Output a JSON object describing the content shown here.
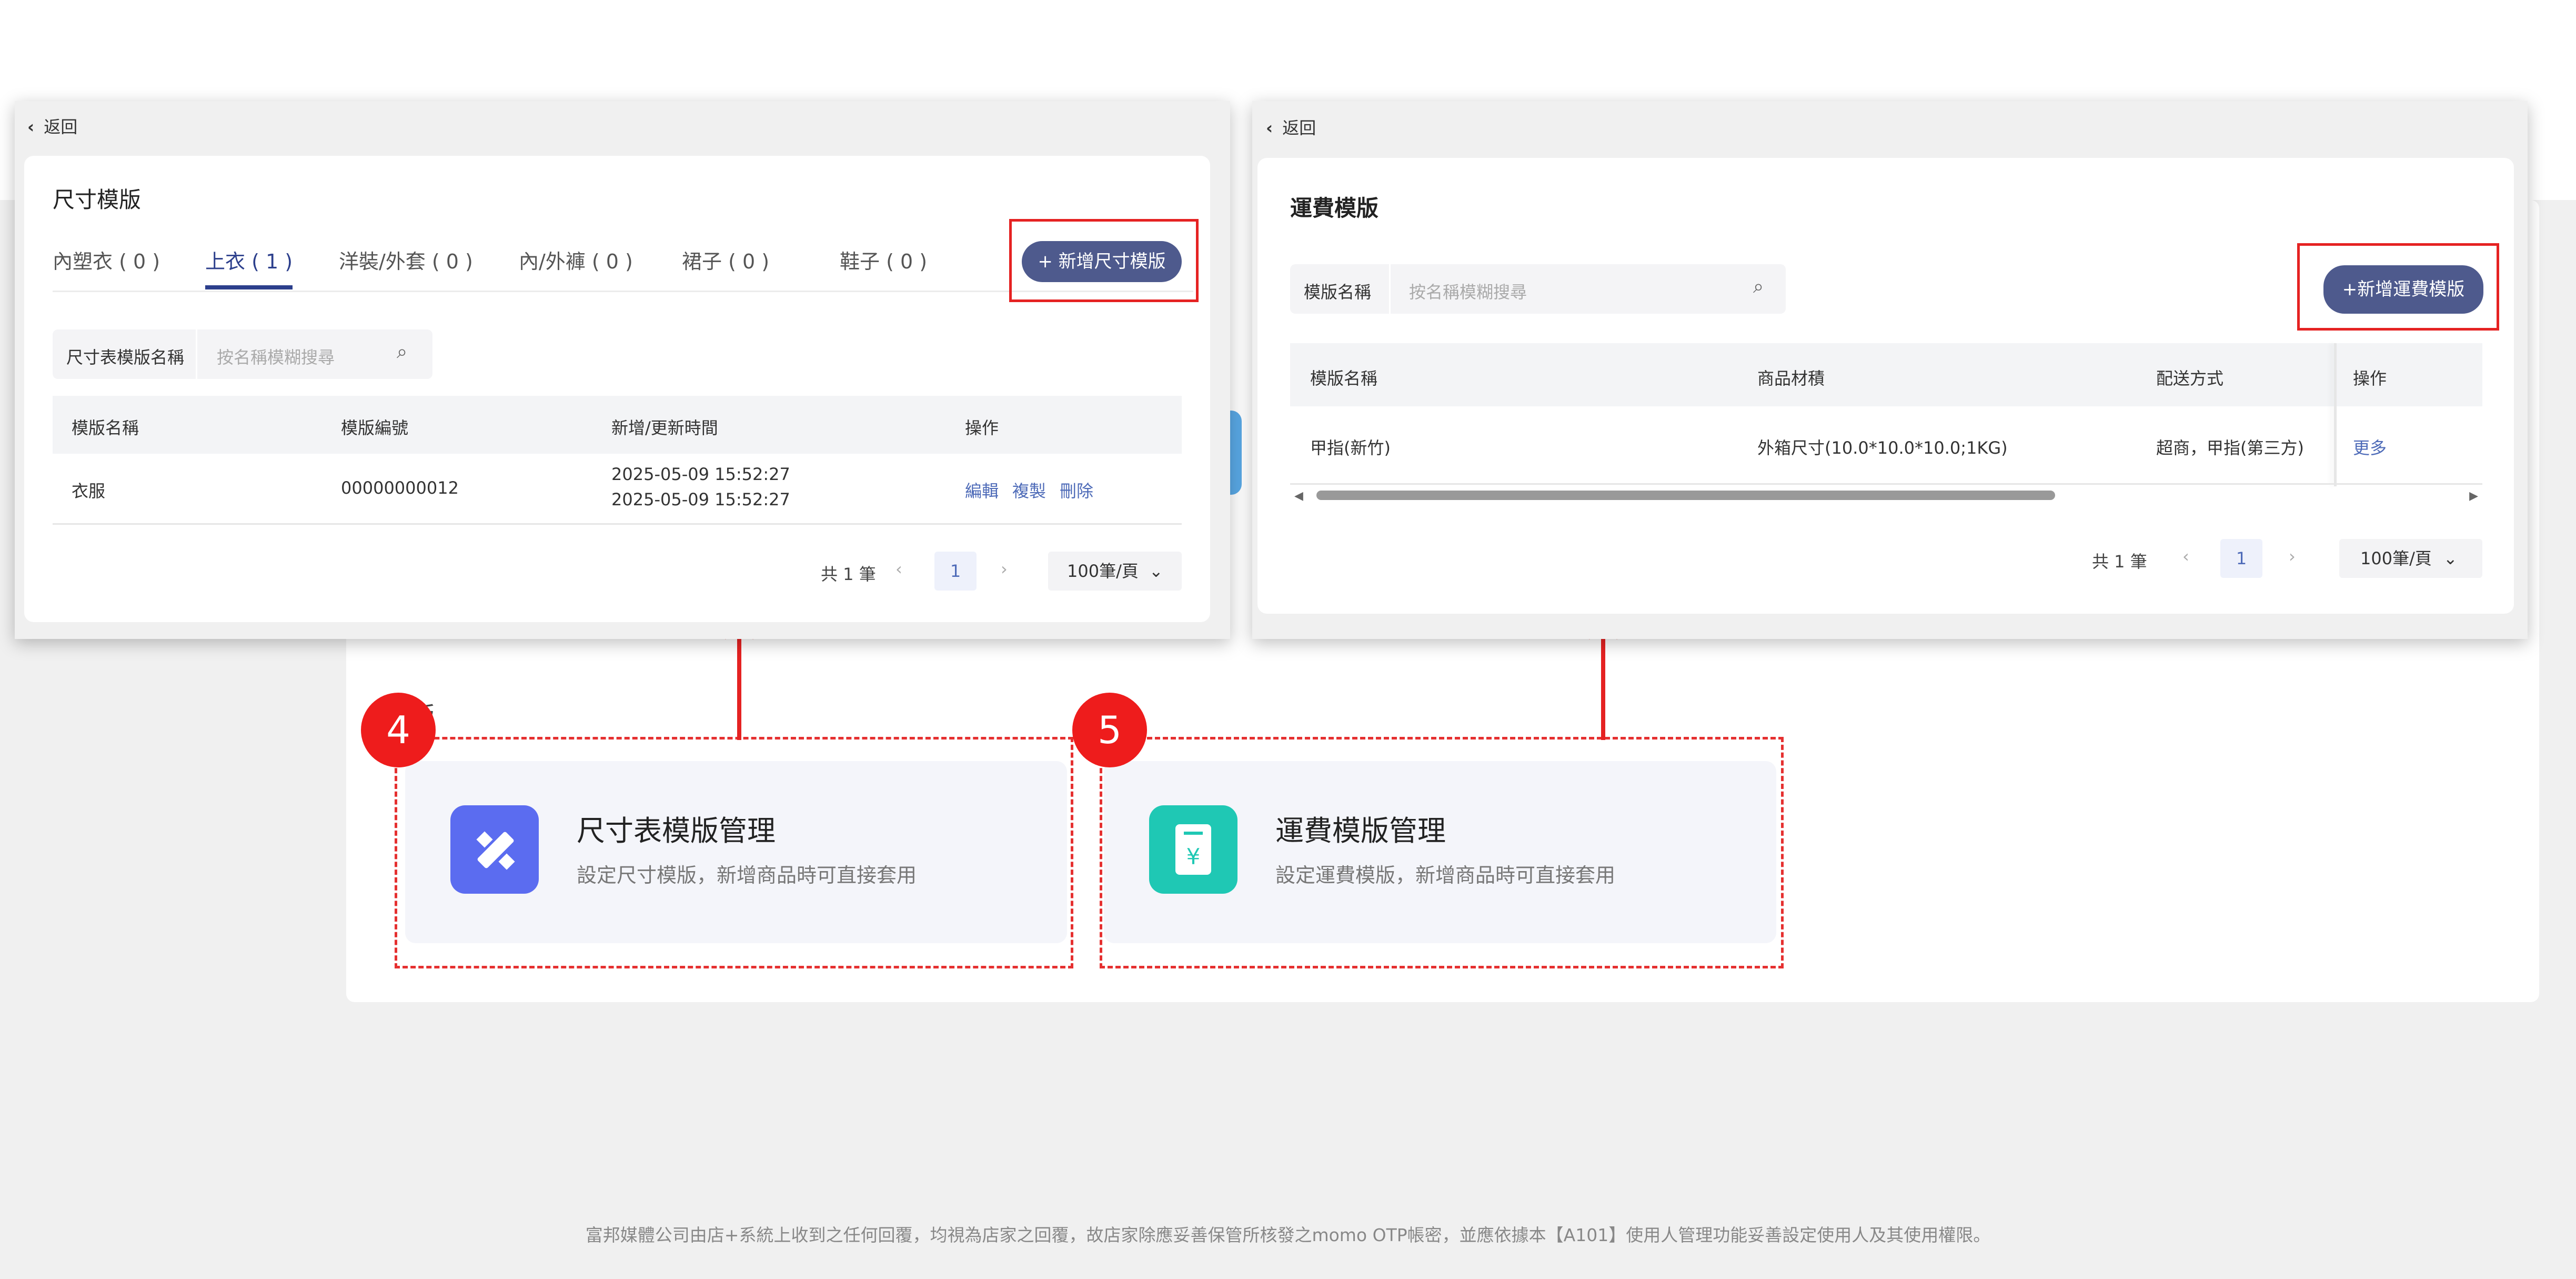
{
  "size_panel": {
    "back_label": "返回",
    "title": "尺寸模版",
    "tabs": [
      "內塑衣 ( 0 )",
      "上衣 ( 1 )",
      "洋裝/外套 ( 0 )",
      "內/外褲 ( 0 )",
      "裙子 ( 0 )",
      "鞋子 ( 0 )"
    ],
    "active_tab": 1,
    "add_button": "+  新增尺寸模版",
    "search_label": "尺寸表模版名稱",
    "search_placeholder": "按名稱模糊搜尋",
    "columns": [
      "模版名稱",
      "模版編號",
      "新增/更新時間",
      "操作"
    ],
    "rows": [
      {
        "name": "衣服",
        "code": "00000000012",
        "time_created": "2025-05-09 15:52:27",
        "time_updated": "2025-05-09 15:52:27",
        "actions": [
          "編輯",
          "複製",
          "刪除"
        ]
      }
    ],
    "total": "共 1 筆",
    "page": "1",
    "page_size": "100筆/頁"
  },
  "shipping_panel": {
    "back_label": "返回",
    "title": "運費模版",
    "search_label": "模版名稱",
    "search_placeholder": "按名稱模糊搜尋",
    "add_button": "+新增運費模版",
    "columns": [
      "模版名稱",
      "商品材積",
      "配送方式",
      "操作"
    ],
    "rows": [
      {
        "name": "甲指(新竹)",
        "volume": "外箱尺寸(10.0*10.0*10.0;1KG)",
        "delivery": "超商，甲指(第三方)",
        "action": "更多"
      }
    ],
    "total": "共 1 筆",
    "page": "1",
    "page_size": "100筆/頁"
  },
  "section_label": "版",
  "features": [
    {
      "badge": "4",
      "title": "尺寸表模版管理",
      "desc": "設定尺寸模版，新增商品時可直接套用",
      "icon": "ruler-pencil-icon",
      "icon_color": "#5b6cf0"
    },
    {
      "badge": "5",
      "title": "運費模版管理",
      "desc": "設定運費模版，新增商品時可直接套用",
      "icon": "yen-receipt-icon",
      "icon_color": "#1fc8b4"
    }
  ],
  "footer": "富邦媒體公司由店+系統上收到之任何回覆，均視為店家之回覆，故店家除應妥善保管所核發之momo OTP帳密，並應依據本【A101】使用人管理功能妥善設定使用人及其使用權限。",
  "colors": {
    "accent": "#4e5a8d",
    "highlight": "#e52222",
    "link": "#4e6bb8"
  }
}
